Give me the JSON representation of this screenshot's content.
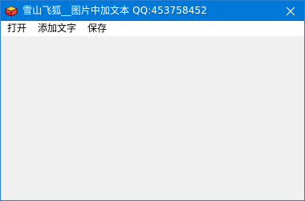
{
  "window": {
    "title": "雪山飞狐__图片中加文本  QQ:453758452",
    "close_icon": "close-icon",
    "app_icon": "app-icon",
    "colors": {
      "titlebar": "#0078d7",
      "border": "#2b7fd4",
      "client": "#f0f0f0",
      "menubar": "#ffffff"
    }
  },
  "menu": {
    "items": [
      {
        "label": "打开"
      },
      {
        "label": "添加文字"
      },
      {
        "label": "保存"
      }
    ]
  }
}
